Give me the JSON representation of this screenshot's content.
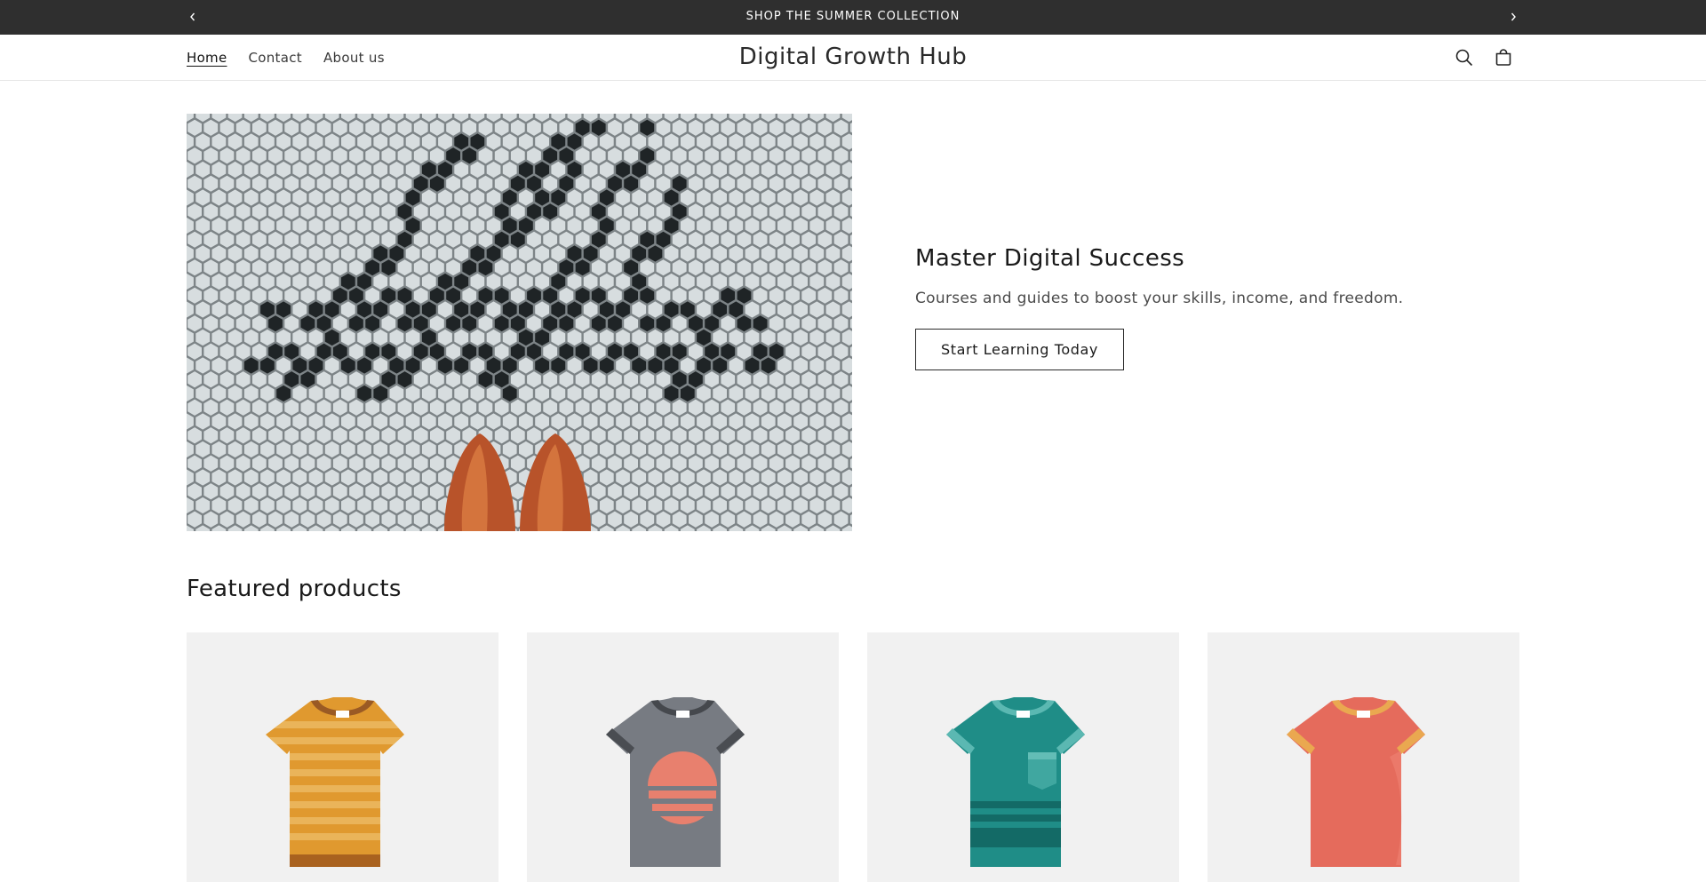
{
  "announcement": {
    "text": "SHOP THE SUMMER COLLECTION",
    "prev_icon": "chevron-left-icon",
    "next_icon": "chevron-right-icon"
  },
  "header": {
    "logo": "Digital Growth Hub",
    "nav": [
      {
        "label": "Home",
        "active": true
      },
      {
        "label": "Contact",
        "active": false
      },
      {
        "label": "About us",
        "active": false
      }
    ],
    "icons": [
      "search-icon",
      "cart-icon"
    ]
  },
  "hero": {
    "title": "Master Digital Success",
    "subtitle": "Courses and guides to boost your skills, income, and freedom.",
    "button_label": "Start Learning Today"
  },
  "featured": {
    "title": "Featured products",
    "products": [
      {
        "shirt_color": "#e0992f",
        "style": "striped"
      },
      {
        "shirt_color": "#777b82",
        "style": "sunset"
      },
      {
        "shirt_color": "#1f8d87",
        "style": "pocket"
      },
      {
        "shirt_color": "#e56b5c",
        "style": "plain"
      }
    ]
  },
  "colors": {
    "announcement_bg": "#2f2f2f",
    "card_bg": "#f1f1f1"
  }
}
